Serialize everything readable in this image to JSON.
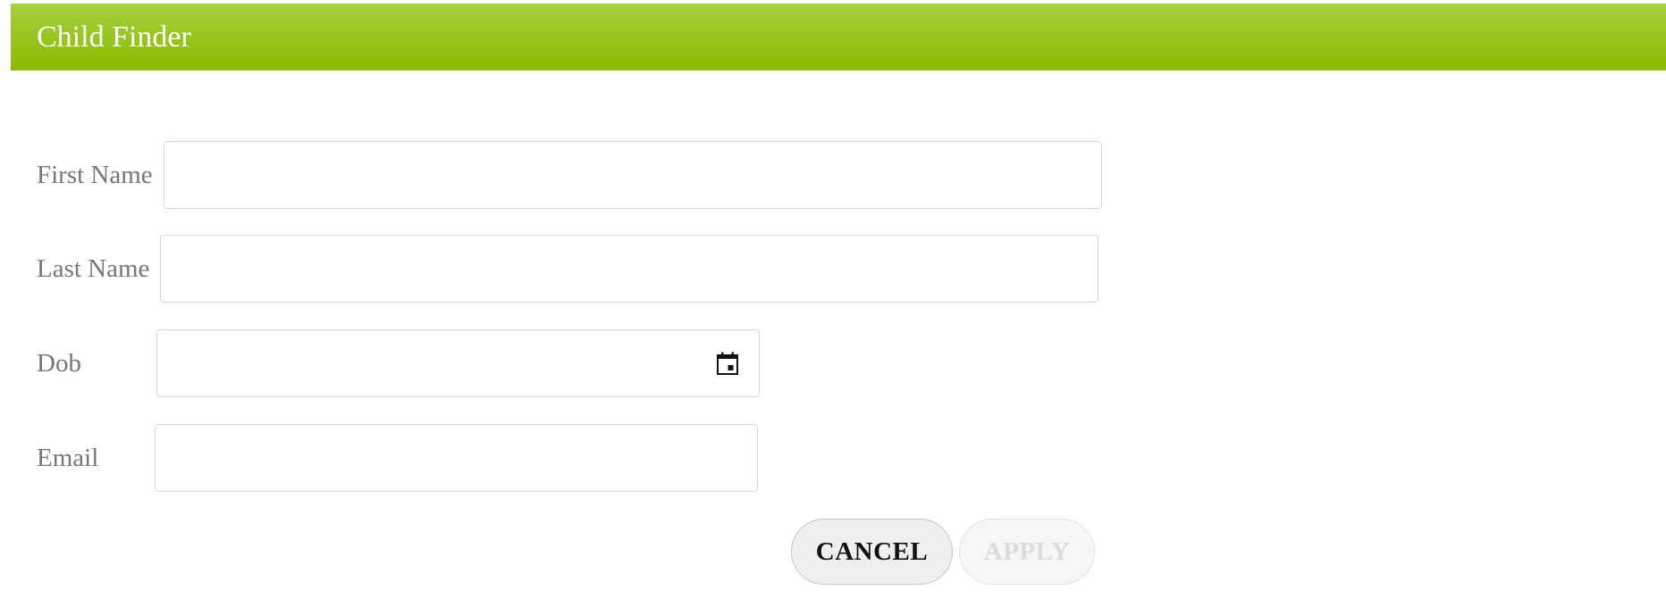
{
  "header": {
    "title": "Child Finder"
  },
  "form": {
    "first_name": {
      "label": "First Name",
      "value": "",
      "placeholder": ""
    },
    "last_name": {
      "label": "Last Name",
      "value": "",
      "placeholder": ""
    },
    "dob": {
      "label": "Dob",
      "value": "",
      "placeholder": "",
      "icon": "calendar-icon"
    },
    "email": {
      "label": "Email",
      "value": "",
      "placeholder": ""
    }
  },
  "actions": {
    "cancel_label": "CANCEL",
    "apply_label": "APPLY",
    "apply_enabled": false
  },
  "colors": {
    "header_accent": "#96c51c",
    "header_text": "#ffffff",
    "label_text": "#777777"
  }
}
